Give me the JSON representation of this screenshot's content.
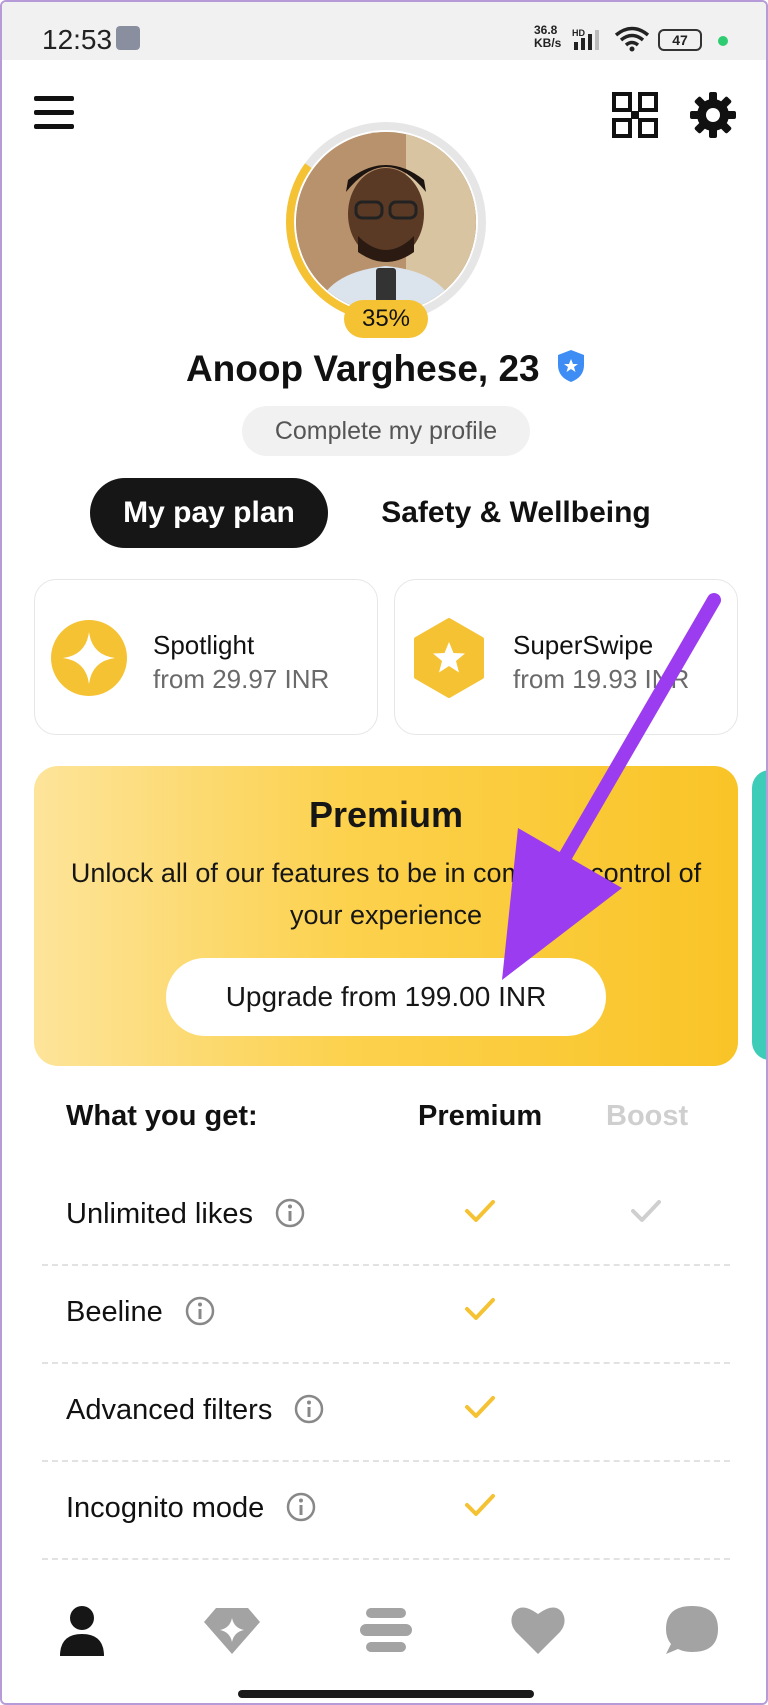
{
  "status_bar": {
    "time": "12:53",
    "net_speed_value": "36.8",
    "net_speed_unit": "KB/s",
    "network_type": "HD",
    "battery": "47"
  },
  "profile": {
    "completion": "35%",
    "name": "Anoop Varghese, 23",
    "complete_button": "Complete my profile"
  },
  "tabs": [
    {
      "label": "My pay plan",
      "active": true
    },
    {
      "label": "Safety & Wellbeing",
      "active": false
    }
  ],
  "features": [
    {
      "title": "Spotlight",
      "subtitle": "from 29.97 INR",
      "icon": "sparkle-icon"
    },
    {
      "title": "SuperSwipe",
      "subtitle": "from 19.93 INR",
      "icon": "star-hexagon-icon"
    }
  ],
  "premium": {
    "title": "Premium",
    "description": "Unlock all of our features to be in complete control of your experience",
    "upgrade_button": "Upgrade from 199.00 INR"
  },
  "comparison": {
    "header_feature": "What you get:",
    "header_premium": "Premium",
    "header_boost": "Boost",
    "rows": [
      {
        "label": "Unlimited likes",
        "premium": true,
        "boost": true
      },
      {
        "label": "Beeline",
        "premium": true,
        "boost": false
      },
      {
        "label": "Advanced filters",
        "premium": true,
        "boost": false
      },
      {
        "label": "Incognito mode",
        "premium": true,
        "boost": false
      }
    ]
  },
  "bottom_nav": [
    {
      "name": "profile",
      "icon": "person-icon",
      "active": true
    },
    {
      "name": "discover",
      "icon": "diamond-sparkle-icon",
      "active": false
    },
    {
      "name": "people",
      "icon": "stack-icon",
      "active": false
    },
    {
      "name": "liked-you",
      "icon": "heart-icon",
      "active": false
    },
    {
      "name": "chats",
      "icon": "chat-bubble-icon",
      "active": false
    }
  ],
  "colors": {
    "accent_yellow": "#f5c234",
    "tab_active_bg": "#161616",
    "check_premium": "#f5c234",
    "check_boost": "#cfcfcf",
    "annotation_arrow": "#9b3cf0",
    "teal_card": "#3cccb8"
  }
}
